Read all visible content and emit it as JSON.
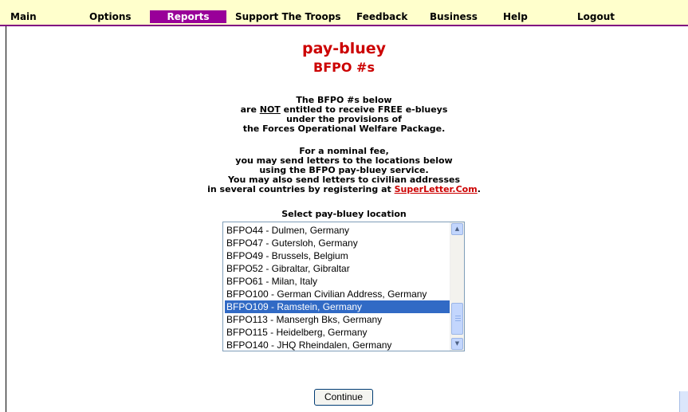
{
  "nav": {
    "items": [
      {
        "label": "Main",
        "active": false
      },
      {
        "label": "Options",
        "active": false
      },
      {
        "label": "Reports",
        "active": true
      },
      {
        "label": "Support The Troops",
        "active": false
      },
      {
        "label": "Feedback",
        "active": false
      },
      {
        "label": "Business",
        "active": false
      },
      {
        "label": "Help",
        "active": false
      },
      {
        "label": "Logout",
        "active": false
      }
    ]
  },
  "page": {
    "title": "pay-bluey",
    "subtitle": "BFPO #s"
  },
  "info": {
    "para1": {
      "line1": "The BFPO #s below",
      "line2_pre": "are ",
      "line2_emph": "NOT",
      "line2_post": " entitled to receive FREE e-blueys",
      "line3": "under the provisions of",
      "line4": "the Forces Operational Welfare Package."
    },
    "para2": {
      "line1": "For a nominal fee,",
      "line2": "you may send letters to the locations below",
      "line3": "using the BFPO pay-bluey service.",
      "line4": "You may also send letters to civilian addresses",
      "line5_pre": "in several countries by registering at ",
      "link": "SuperLetter.Com",
      "line5_post": "."
    }
  },
  "select": {
    "label": "Select pay-bluey location",
    "options": [
      "BFPO44 - Dulmen, Germany",
      "BFPO47 - Gutersloh, Germany",
      "BFPO49 - Brussels, Belgium",
      "BFPO52 - Gibraltar, Gibraltar",
      "BFPO61 - Milan, Italy",
      "BFPO100 - German Civilian Address, Germany",
      "BFPO109 - Ramstein, Germany",
      "BFPO113 - Mansergh Bks, Germany",
      "BFPO115 - Heidelberg, Germany",
      "BFPO140 - JHQ Rheindalen, Germany"
    ],
    "selected": "BFPO109 - Ramstein, Germany"
  },
  "actions": {
    "continue": "Continue"
  },
  "colors": {
    "nav_bg": "#ffffcc",
    "nav_active": "#990099",
    "title_red": "#cc0000",
    "selection": "#316ac5"
  },
  "icons": {
    "scroll_up": "scroll-up-arrow-icon",
    "scroll_down": "scroll-down-arrow-icon"
  }
}
